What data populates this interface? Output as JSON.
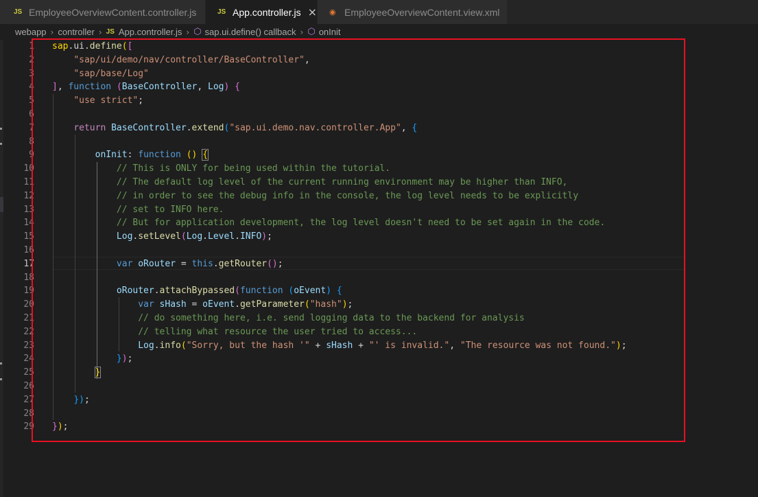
{
  "tabs": [
    {
      "label": "EmployeeOverviewContent.controller.js",
      "icon": "JS",
      "active": false
    },
    {
      "label": "App.controller.js",
      "icon": "JS",
      "active": true
    },
    {
      "label": "EmployeeOverviewContent.view.xml",
      "icon": "rss-icon",
      "active": false
    }
  ],
  "breadcrumb": {
    "items": [
      "webapp",
      "controller",
      "App.controller.js",
      "sap.ui.define() callback",
      "onInit"
    ],
    "js_badge": "JS"
  },
  "editor": {
    "current_line": 17,
    "highlight_color": "#e81123",
    "line_numbers": [
      "1",
      "2",
      "3",
      "4",
      "5",
      "6",
      "7",
      "8",
      "9",
      "10",
      "11",
      "12",
      "13",
      "14",
      "15",
      "16",
      "17",
      "18",
      "19",
      "20",
      "21",
      "22",
      "23",
      "24",
      "25",
      "26",
      "27",
      "28",
      "29"
    ],
    "lines": [
      [
        [
          "p1",
          "sap"
        ],
        [
          "pun",
          "."
        ],
        [
          "pun",
          "ui"
        ],
        [
          "pun",
          "."
        ],
        [
          "fn",
          "define"
        ],
        [
          "p1",
          "("
        ],
        [
          "p2",
          "["
        ]
      ],
      [
        [
          "pun",
          "    "
        ],
        [
          "str",
          "\"sap/ui/demo/nav/controller/BaseController\""
        ],
        [
          "pun",
          ","
        ]
      ],
      [
        [
          "pun",
          "    "
        ],
        [
          "str",
          "\"sap/base/Log\""
        ]
      ],
      [
        [
          "p2",
          "]"
        ],
        [
          "pun",
          ", "
        ],
        [
          "kw",
          "function"
        ],
        [
          "pun",
          " "
        ],
        [
          "p2",
          "("
        ],
        [
          "var",
          "BaseController"
        ],
        [
          "pun",
          ", "
        ],
        [
          "var",
          "Log"
        ],
        [
          "p2",
          ")"
        ],
        [
          "pun",
          " "
        ],
        [
          "p2",
          "{"
        ]
      ],
      [
        [
          "pun",
          "    "
        ],
        [
          "str",
          "\"use strict\""
        ],
        [
          "pun",
          ";"
        ]
      ],
      [
        [
          "pun",
          ""
        ]
      ],
      [
        [
          "pun",
          "    "
        ],
        [
          "ctl",
          "return"
        ],
        [
          "pun",
          " "
        ],
        [
          "var",
          "BaseController"
        ],
        [
          "pun",
          "."
        ],
        [
          "fn",
          "extend"
        ],
        [
          "p3",
          "("
        ],
        [
          "str",
          "\"sap.ui.demo.nav.controller.App\""
        ],
        [
          "pun",
          ", "
        ],
        [
          "p3",
          "{"
        ]
      ],
      [
        [
          "pun",
          ""
        ]
      ],
      [
        [
          "pun",
          "        "
        ],
        [
          "var",
          "onInit"
        ],
        [
          "pun",
          ": "
        ],
        [
          "kw",
          "function"
        ],
        [
          "pun",
          " "
        ],
        [
          "p1",
          "()"
        ],
        [
          "pun",
          " "
        ],
        [
          "p1",
          "{"
        ]
      ],
      [
        [
          "pun",
          "            "
        ],
        [
          "cmt",
          "// This is ONLY for being used within the tutorial."
        ]
      ],
      [
        [
          "pun",
          "            "
        ],
        [
          "cmt",
          "// The default log level of the current running environment may be higher than INFO,"
        ]
      ],
      [
        [
          "pun",
          "            "
        ],
        [
          "cmt",
          "// in order to see the debug info in the console, the log level needs to be explicitly"
        ]
      ],
      [
        [
          "pun",
          "            "
        ],
        [
          "cmt",
          "// set to INFO here."
        ]
      ],
      [
        [
          "pun",
          "            "
        ],
        [
          "cmt",
          "// But for application development, the log level doesn't need to be set again in the code."
        ]
      ],
      [
        [
          "pun",
          "            "
        ],
        [
          "var",
          "Log"
        ],
        [
          "pun",
          "."
        ],
        [
          "fn",
          "setLevel"
        ],
        [
          "p2",
          "("
        ],
        [
          "var",
          "Log"
        ],
        [
          "pun",
          "."
        ],
        [
          "var",
          "Level"
        ],
        [
          "pun",
          "."
        ],
        [
          "var",
          "INFO"
        ],
        [
          "p2",
          ")"
        ],
        [
          "pun",
          ";"
        ]
      ],
      [
        [
          "pun",
          ""
        ]
      ],
      [
        [
          "pun",
          "            "
        ],
        [
          "kw",
          "var"
        ],
        [
          "pun",
          " "
        ],
        [
          "var",
          "oRouter"
        ],
        [
          "pun",
          " = "
        ],
        [
          "kw",
          "this"
        ],
        [
          "pun",
          "."
        ],
        [
          "fn",
          "getRouter"
        ],
        [
          "p2",
          "()"
        ],
        [
          "pun",
          ";"
        ]
      ],
      [
        [
          "pun",
          ""
        ]
      ],
      [
        [
          "pun",
          "            "
        ],
        [
          "var",
          "oRouter"
        ],
        [
          "pun",
          "."
        ],
        [
          "fn",
          "attachBypassed"
        ],
        [
          "p2",
          "("
        ],
        [
          "kw",
          "function"
        ],
        [
          "pun",
          " "
        ],
        [
          "p3",
          "("
        ],
        [
          "var",
          "oEvent"
        ],
        [
          "p3",
          ")"
        ],
        [
          "pun",
          " "
        ],
        [
          "p3",
          "{"
        ]
      ],
      [
        [
          "pun",
          "                "
        ],
        [
          "kw",
          "var"
        ],
        [
          "pun",
          " "
        ],
        [
          "var",
          "sHash"
        ],
        [
          "pun",
          " = "
        ],
        [
          "var",
          "oEvent"
        ],
        [
          "pun",
          "."
        ],
        [
          "fn",
          "getParameter"
        ],
        [
          "p1",
          "("
        ],
        [
          "str",
          "\"hash\""
        ],
        [
          "p1",
          ")"
        ],
        [
          "pun",
          ";"
        ]
      ],
      [
        [
          "pun",
          "                "
        ],
        [
          "cmt",
          "// do something here, i.e. send logging data to the backend for analysis"
        ]
      ],
      [
        [
          "pun",
          "                "
        ],
        [
          "cmt",
          "// telling what resource the user tried to access..."
        ]
      ],
      [
        [
          "pun",
          "                "
        ],
        [
          "var",
          "Log"
        ],
        [
          "pun",
          "."
        ],
        [
          "fn",
          "info"
        ],
        [
          "p1",
          "("
        ],
        [
          "str",
          "\"Sorry, but the hash '\""
        ],
        [
          "pun",
          " + "
        ],
        [
          "var",
          "sHash"
        ],
        [
          "pun",
          " + "
        ],
        [
          "str",
          "\"' is invalid.\""
        ],
        [
          "pun",
          ", "
        ],
        [
          "str",
          "\"The resource was not found.\""
        ],
        [
          "p1",
          ")"
        ],
        [
          "pun",
          ";"
        ]
      ],
      [
        [
          "pun",
          "            "
        ],
        [
          "p3",
          "}"
        ],
        [
          "p2",
          ")"
        ],
        [
          "pun",
          ";"
        ]
      ],
      [
        [
          "pun",
          "        "
        ],
        [
          "p1",
          "}"
        ]
      ],
      [
        [
          "pun",
          ""
        ]
      ],
      [
        [
          "pun",
          "    "
        ],
        [
          "p3",
          "}"
        ],
        [
          "p3",
          ")"
        ],
        [
          "pun",
          ";"
        ]
      ],
      [
        [
          "pun",
          ""
        ]
      ],
      [
        [
          "p2",
          "}"
        ],
        [
          "p1",
          ")"
        ],
        [
          "pun",
          ";"
        ]
      ]
    ]
  }
}
